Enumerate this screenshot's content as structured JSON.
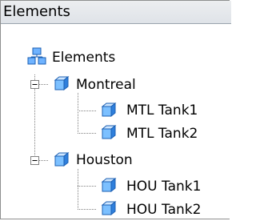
{
  "panel": {
    "title": "Elements"
  },
  "tree": {
    "root": {
      "label": "Elements",
      "icon": "hierarchy-icon"
    },
    "nodes": [
      {
        "label": "Montreal",
        "icon": "cube-icon",
        "expander": "−",
        "children": [
          {
            "label": "MTL Tank1",
            "icon": "cube-icon"
          },
          {
            "label": "MTL Tank2",
            "icon": "cube-icon"
          }
        ]
      },
      {
        "label": "Houston",
        "icon": "cube-icon",
        "expander": "−",
        "children": [
          {
            "label": "HOU Tank1",
            "icon": "cube-icon"
          },
          {
            "label": "HOU Tank2",
            "icon": "cube-icon"
          }
        ]
      }
    ]
  },
  "colors": {
    "cube_light": "#a9d6ff",
    "cube_dark": "#2f7fdc",
    "cube_outline": "#1b5fb3",
    "tree_line": "#808080"
  }
}
